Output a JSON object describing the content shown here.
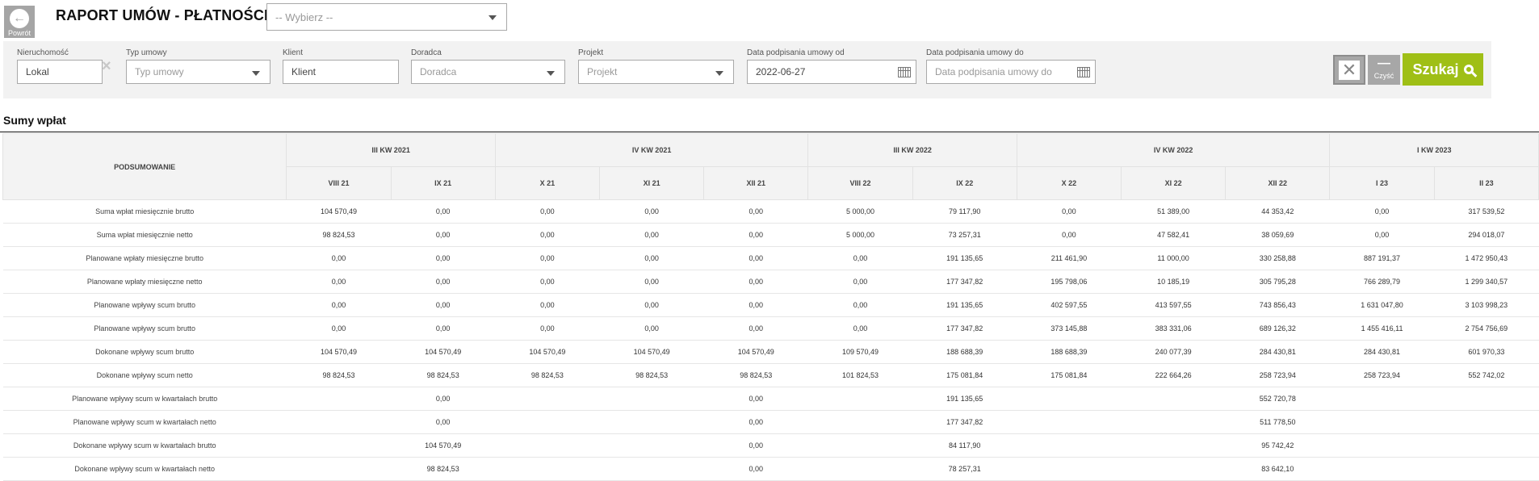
{
  "header": {
    "back_label": "Powrót",
    "title": "RAPORT UMÓW - PŁATNOŚCI",
    "report_select_placeholder": "-- Wybierz --"
  },
  "filters": {
    "nieruchomosc": {
      "label": "Nieruchomość",
      "value": "Lokal"
    },
    "typ_umowy": {
      "label": "Typ umowy",
      "placeholder": "Typ umowy"
    },
    "klient": {
      "label": "Klient",
      "value": "Klient"
    },
    "doradca": {
      "label": "Doradca",
      "placeholder": "Doradca"
    },
    "projekt": {
      "label": "Projekt",
      "placeholder": "Projekt"
    },
    "data_od": {
      "label": "Data podpisania umowy od",
      "value": "2022-06-27"
    },
    "data_do": {
      "label": "Data podpisania umowy do",
      "placeholder": "Data podpisania umowy do"
    }
  },
  "buttons": {
    "clear_label": "Czyść",
    "search_label": "Szukaj"
  },
  "colors": {
    "search_green": "#9fbf16",
    "button_grey": "#a7a7a7"
  },
  "icons": [
    "back-arrow-icon",
    "clear-x-icon",
    "caret-down-icon",
    "calendar-icon",
    "excel-icon",
    "search-icon"
  ],
  "section": {
    "title": "Sumy wpłat",
    "summary_header": "PODSUMOWANIE",
    "quarters": [
      {
        "label": "III KW 2021",
        "span": 2
      },
      {
        "label": "IV KW 2021",
        "span": 3
      },
      {
        "label": "III KW 2022",
        "span": 2
      },
      {
        "label": "IV KW 2022",
        "span": 3
      },
      {
        "label": "I KW 2023",
        "span": 2
      }
    ],
    "months": [
      "VIII 21",
      "IX 21",
      "X 21",
      "XI 21",
      "XII 21",
      "VIII 22",
      "IX 22",
      "X 22",
      "XI 22",
      "XII 22",
      "I 23",
      "II 23"
    ],
    "rows": [
      {
        "label": "Suma wpłat miesięcznie brutto",
        "values": [
          "104 570,49",
          "0,00",
          "0,00",
          "0,00",
          "0,00",
          "5 000,00",
          "79 117,90",
          "0,00",
          "51 389,00",
          "44 353,42",
          "0,00",
          "317 539,52"
        ]
      },
      {
        "label": "Suma wpłat miesięcznie netto",
        "values": [
          "98 824,53",
          "0,00",
          "0,00",
          "0,00",
          "0,00",
          "5 000,00",
          "73 257,31",
          "0,00",
          "47 582,41",
          "38 059,69",
          "0,00",
          "294 018,07"
        ]
      },
      {
        "label": "Planowane wpłaty miesięczne brutto",
        "values": [
          "0,00",
          "0,00",
          "0,00",
          "0,00",
          "0,00",
          "0,00",
          "191 135,65",
          "211 461,90",
          "11 000,00",
          "330 258,88",
          "887 191,37",
          "1 472 950,43"
        ]
      },
      {
        "label": "Planowane wpłaty miesięczne netto",
        "values": [
          "0,00",
          "0,00",
          "0,00",
          "0,00",
          "0,00",
          "0,00",
          "177 347,82",
          "195 798,06",
          "10 185,19",
          "305 795,28",
          "766 289,79",
          "1 299 340,57"
        ]
      },
      {
        "label": "Planowane wpływy scum brutto",
        "values": [
          "0,00",
          "0,00",
          "0,00",
          "0,00",
          "0,00",
          "0,00",
          "191 135,65",
          "402 597,55",
          "413 597,55",
          "743 856,43",
          "1 631 047,80",
          "3 103 998,23"
        ]
      },
      {
        "label": "Planowane wpływy scum brutto",
        "values": [
          "0,00",
          "0,00",
          "0,00",
          "0,00",
          "0,00",
          "0,00",
          "177 347,82",
          "373 145,88",
          "383 331,06",
          "689 126,32",
          "1 455 416,11",
          "2 754 756,69"
        ]
      },
      {
        "label": "Dokonane wpływy scum brutto",
        "values": [
          "104 570,49",
          "104 570,49",
          "104 570,49",
          "104 570,49",
          "104 570,49",
          "109 570,49",
          "188 688,39",
          "188 688,39",
          "240 077,39",
          "284 430,81",
          "284 430,81",
          "601 970,33"
        ]
      },
      {
        "label": "Dokonane wpływy scum netto",
        "values": [
          "98 824,53",
          "98 824,53",
          "98 824,53",
          "98 824,53",
          "98 824,53",
          "101 824,53",
          "175 081,84",
          "175 081,84",
          "222 664,26",
          "258 723,94",
          "258 723,94",
          "552 742,02"
        ]
      },
      {
        "label": "Planowane wpływy scum w kwartałach brutto",
        "values": [
          "",
          "0,00",
          "",
          "",
          "0,00",
          "",
          "191 135,65",
          "",
          "",
          "552 720,78",
          "",
          ""
        ]
      },
      {
        "label": "Planowane wpływy scum w kwartałach netto",
        "values": [
          "",
          "0,00",
          "",
          "",
          "0,00",
          "",
          "177 347,82",
          "",
          "",
          "511 778,50",
          "",
          ""
        ]
      },
      {
        "label": "Dokonane wpływy scum w kwartałach brutto",
        "values": [
          "",
          "104 570,49",
          "",
          "",
          "0,00",
          "",
          "84 117,90",
          "",
          "",
          "95 742,42",
          "",
          ""
        ]
      },
      {
        "label": "Dokonane wpływy scum w kwartałach netto",
        "values": [
          "",
          "98 824,53",
          "",
          "",
          "0,00",
          "",
          "78 257,31",
          "",
          "",
          "83 642,10",
          "",
          ""
        ]
      }
    ]
  }
}
